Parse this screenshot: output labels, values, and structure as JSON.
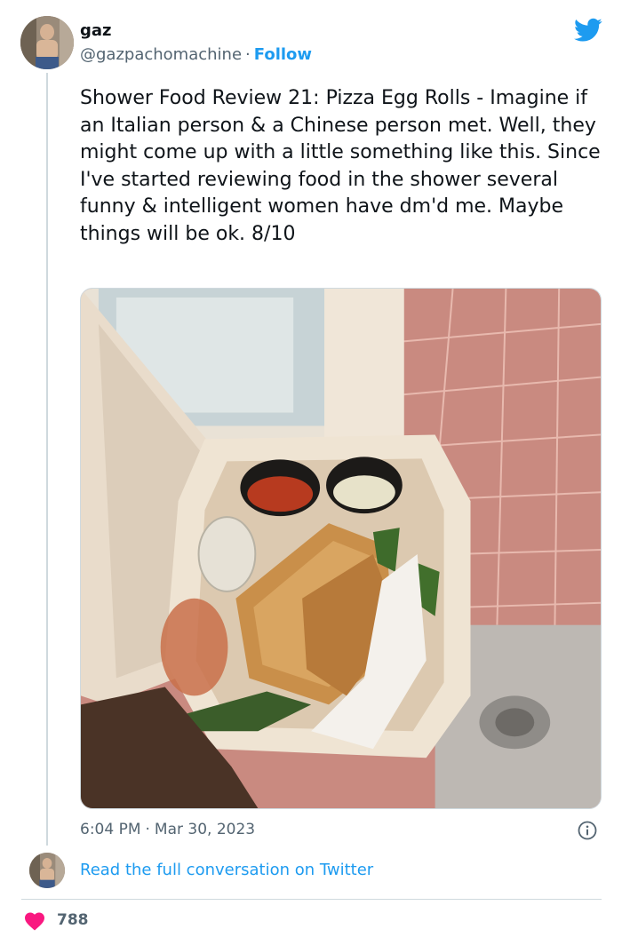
{
  "colors": {
    "accent": "#1d9bf0",
    "text": "#0f1419",
    "muted": "#536471",
    "heart": "#f91880",
    "border": "#cfd9de"
  },
  "header": {
    "display_name": "gaz",
    "handle": "@gazpachomachine",
    "separator": "·",
    "follow_label": "Follow",
    "logo_icon": "twitter-bird-icon"
  },
  "tweet": {
    "text": "Shower Food Review 21: Pizza Egg Rolls - Imagine if an Italian person & a Chinese person met. Well, they might come up with a little something like this. Since I've started reviewing food in the shower several funny & intelligent women have dm'd me. Maybe things will be ok. 8/10",
    "time": "6:04 PM",
    "separator": "·",
    "date": "Mar 30, 2023",
    "info_icon": "info-icon"
  },
  "media": {
    "type": "photo",
    "subject": "pizza-egg-rolls-in-takeout-container"
  },
  "conversation": {
    "link_label": "Read the full conversation on Twitter"
  },
  "engagement": {
    "heart_icon": "heart-icon",
    "like_count": "788"
  }
}
